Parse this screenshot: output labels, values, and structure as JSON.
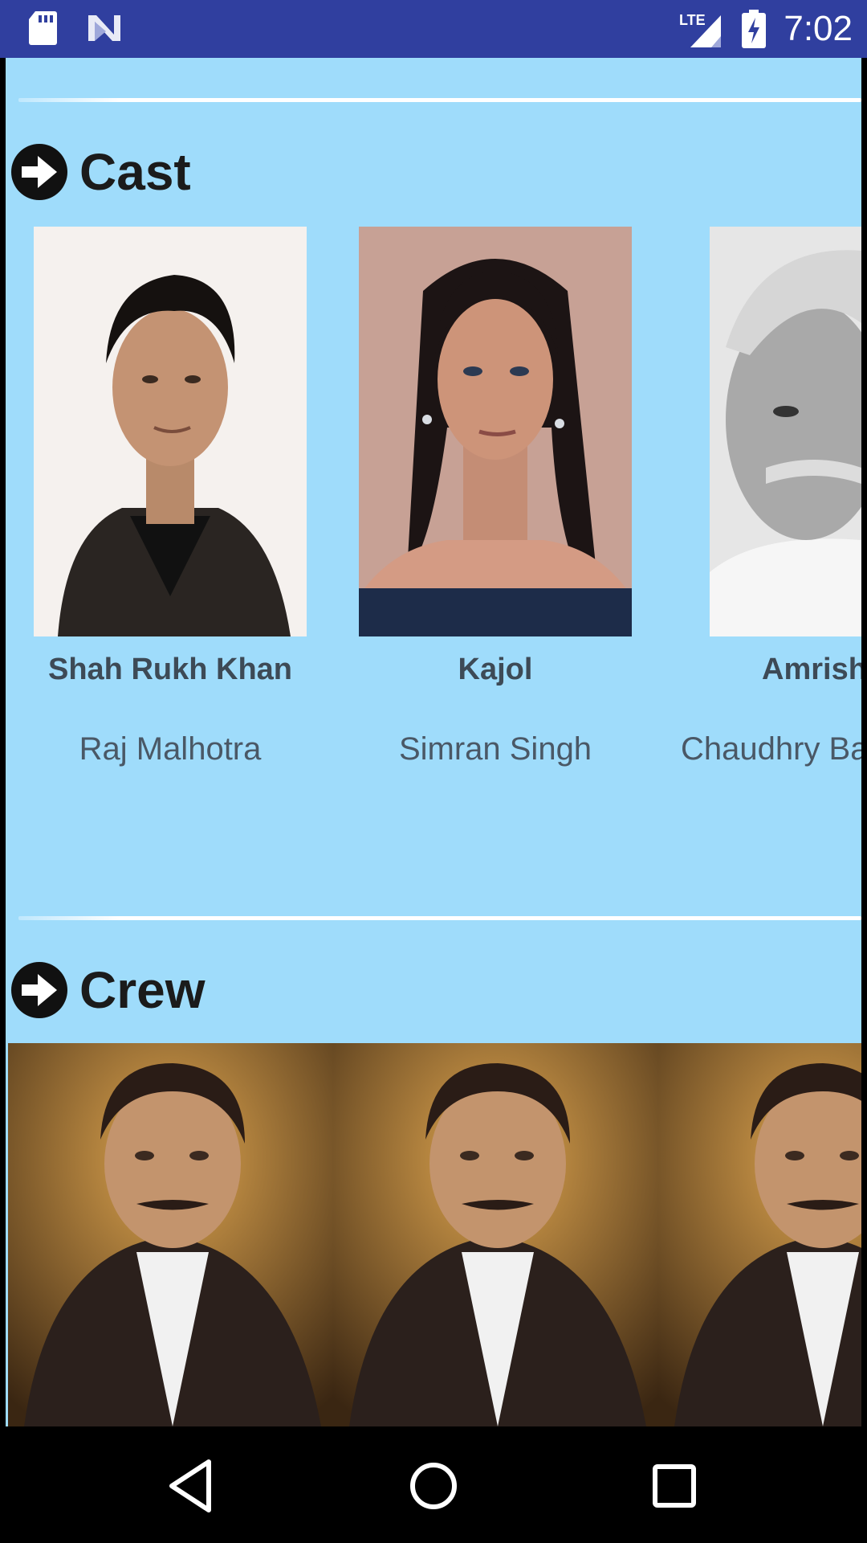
{
  "status_bar": {
    "time": "7:02",
    "network": "LTE",
    "icons": [
      "sd-card-icon",
      "n-logo-icon",
      "signal-icon",
      "battery-charging-icon"
    ]
  },
  "sections": {
    "cast": {
      "title": "Cast",
      "members": [
        {
          "name": "Shah Rukh Khan",
          "role": "Raj Malhotra"
        },
        {
          "name": "Kajol",
          "role": "Simran Singh"
        },
        {
          "name": "Amrish",
          "role": "Chaudhry Ba"
        }
      ]
    },
    "crew": {
      "title": "Crew"
    }
  },
  "colors": {
    "status_bar": "#303f9f",
    "content_bg": "#9fdcfb",
    "title_text": "#1b1b1b",
    "name_text": "#3d4a56"
  },
  "nav": {
    "icons": [
      "back-icon",
      "home-icon",
      "recents-icon"
    ]
  }
}
